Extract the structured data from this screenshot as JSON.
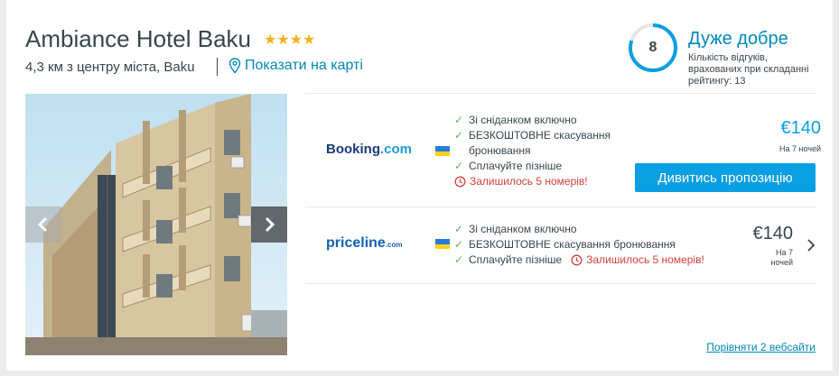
{
  "hotel": {
    "name": "Ambiance Hotel Baku",
    "stars": "★★★★",
    "distance": "4,3 км з центру міста, Baku",
    "map_link": "Показати на карті"
  },
  "rating": {
    "score": "8",
    "fraction": 0.8,
    "label": "Дуже добре",
    "description": "Кількість відгуків, врахованих при складанні рейтингу: 13"
  },
  "colors": {
    "accent": "#0088b8",
    "button": "#0a9ee2",
    "stars": "#f5b21c",
    "check": "#5ab65a",
    "warning": "#d43f3a"
  },
  "offers": [
    {
      "provider_main": "Booking",
      "provider_suffix": ".com",
      "features": [
        "Зі сніданком включно",
        "БЕЗКОШТОВНЕ скасування бронювання",
        "Сплачуйте пізніше"
      ],
      "warning": "Залишилось 5 номерів!",
      "price": "€140",
      "per_night": "На 7 ночей",
      "button": "Дивитись пропозицію"
    },
    {
      "provider_main": "priceline",
      "provider_suffix": ".com",
      "features": [
        "Зі сніданком включно",
        "БЕЗКОШТОВНЕ скасування бронювання",
        "Сплачуйте пізніше"
      ],
      "warning": "Залишилось 5 номерів!",
      "price": "€140",
      "per_night": "На 7 ночей"
    }
  ],
  "compare_link": "Порівняти 2 вебсайти"
}
